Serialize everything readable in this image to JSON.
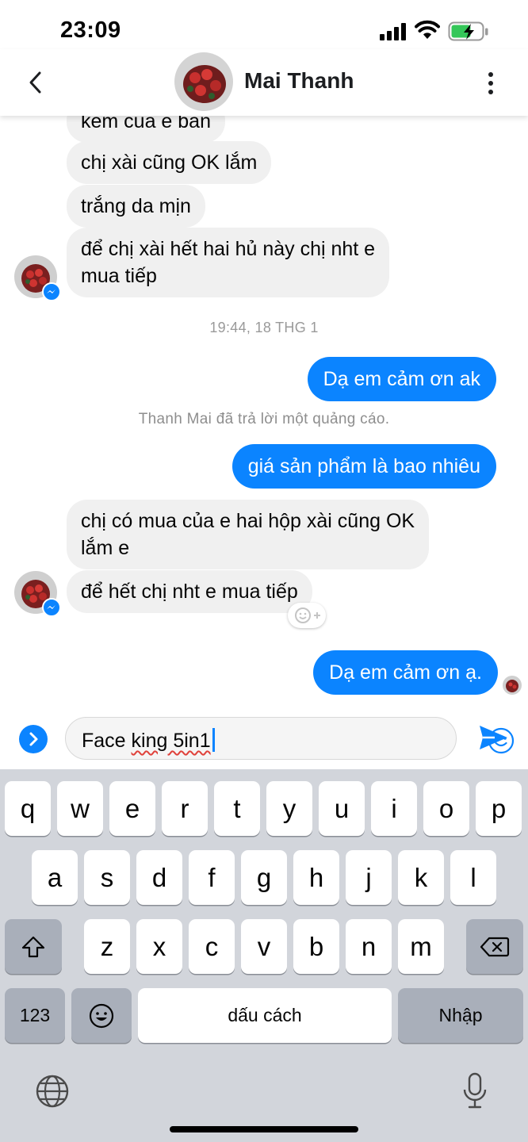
{
  "status_bar": {
    "time": "23:09"
  },
  "header": {
    "contact_name": "Mai Thanh"
  },
  "messages": {
    "m1": "kem của e bán",
    "m2": "chị xài cũng OK lắm",
    "m3": "trắng da mịn",
    "m4_line1": "để chị xài hết hai hủ này chị nht e",
    "m4_line2": "mua tiếp",
    "timestamp": "19:44, 18 THG 1",
    "m5": "Dạ em cảm ơn ak",
    "system_note": "Thanh Mai đã trả lời một quảng cáo.",
    "m6": "giá sản phẩm là bao nhiêu",
    "m7_line1": "chị có mua của e hai hộp xài cũng OK",
    "m7_line2": "lắm e",
    "m8": "để hết chị nht e mua tiếp",
    "m9": "Dạ em cảm ơn ạ."
  },
  "composer": {
    "text_prefix": "Face ",
    "text_misspelled": "king 5in1"
  },
  "keyboard": {
    "row1": [
      "q",
      "w",
      "e",
      "r",
      "t",
      "y",
      "u",
      "i",
      "o",
      "p"
    ],
    "row2": [
      "a",
      "s",
      "d",
      "f",
      "g",
      "h",
      "j",
      "k",
      "l"
    ],
    "row3": [
      "z",
      "x",
      "c",
      "v",
      "b",
      "n",
      "m"
    ],
    "numbers_key": "123",
    "space_key": "dấu cách",
    "return_key": "Nhập"
  },
  "colors": {
    "accent": "#0b84ff",
    "incoming_bubble": "#f0f0f0",
    "keyboard_bg": "#d2d5db"
  },
  "icons": [
    "back-icon",
    "more-icon",
    "signal-icon",
    "wifi-icon",
    "battery-icon",
    "messenger-badge-icon",
    "add-reaction-icon",
    "expand-icon",
    "emoji-icon",
    "send-icon",
    "shift-icon",
    "backspace-icon",
    "emoji-keyboard-icon",
    "globe-icon",
    "microphone-icon"
  ]
}
